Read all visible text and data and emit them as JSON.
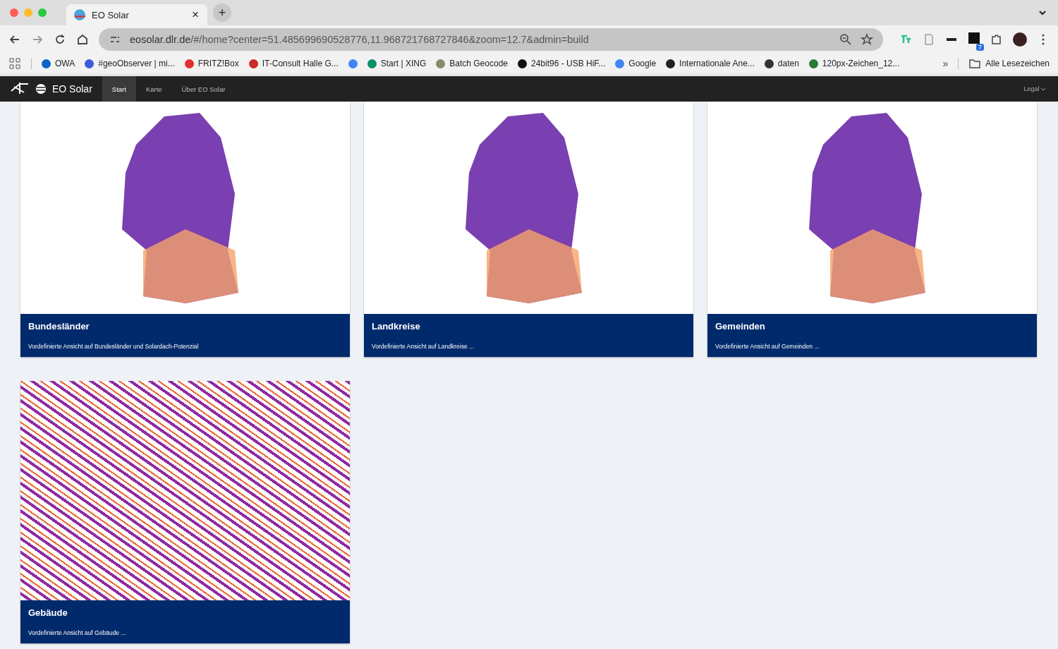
{
  "browser": {
    "tab_title": "EO Solar",
    "close_glyph": "×",
    "new_tab_glyph": "+",
    "url_host": "eosolar.dlr.de",
    "url_path": "/#/home?center=51.485699690528776,11.968721768727846&zoom=12.7&admin=build",
    "extension_badge": "7",
    "bookmarks": [
      {
        "label": "OWA",
        "color": "#0a64c8"
      },
      {
        "label": "#geoObserver | mi...",
        "color": "#3b5bdb"
      },
      {
        "label": "FRITZ!Box",
        "color": "#e03131"
      },
      {
        "label": "IT-Consult Halle G...",
        "color": "#c92a2a"
      },
      {
        "color": "#4285f4"
      },
      {
        "label": "Start | XING",
        "color": "#0a8f6a"
      },
      {
        "label": "Batch Geocode",
        "color": "#8a8a6a"
      },
      {
        "label": "24bit96 - USB HiF...",
        "color": "#111111"
      },
      {
        "label": "Google",
        "color": "#4285f4"
      },
      {
        "label": "Internationale Ane...",
        "color": "#222222"
      },
      {
        "label": "daten",
        "color": "#333333"
      },
      {
        "label": "120px-Zeichen_12...",
        "color": "#2b7a3a"
      }
    ],
    "more_glyph": "»",
    "all_bookmarks": "Alle Lesezeichen"
  },
  "app": {
    "brand": "EO Solar",
    "nav": [
      {
        "label": "Start",
        "selected": true
      },
      {
        "label": "Karte",
        "selected": false
      },
      {
        "label": "Über EO Solar",
        "selected": false
      }
    ],
    "legal": "Legal"
  },
  "cards": [
    {
      "title": "Bundesländer",
      "description": "Vordefinierte Ansicht auf Bundesländer und Solardach-Potenzial",
      "kind": "map"
    },
    {
      "title": "Landkreise",
      "description": "Vordefinierte Ansicht auf Landkreise ...",
      "kind": "map"
    },
    {
      "title": "Gemeinden",
      "description": "Vordefinierte Ansicht auf Gemeinden ...",
      "kind": "map"
    },
    {
      "title": "Gebäude",
      "description": "Vordefinierte Ansicht auf Gebäude ...",
      "kind": "aerial"
    }
  ]
}
